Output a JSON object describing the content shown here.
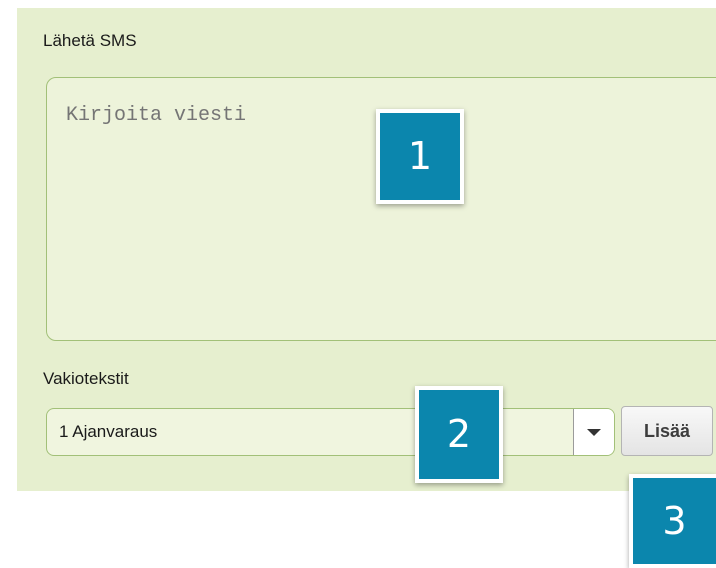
{
  "sms": {
    "title": "Lähetä SMS",
    "message_placeholder": "Kirjoita viesti",
    "message_value": ""
  },
  "templates": {
    "label": "Vakiotekstit",
    "selected": "1 Ajanvaraus",
    "add_label": "Lisää"
  },
  "callouts": [
    "1",
    "2",
    "3"
  ],
  "colors": {
    "panel_background": "#e6efcf",
    "field_border": "#a2c078",
    "callout_background": "#0b86ad"
  }
}
